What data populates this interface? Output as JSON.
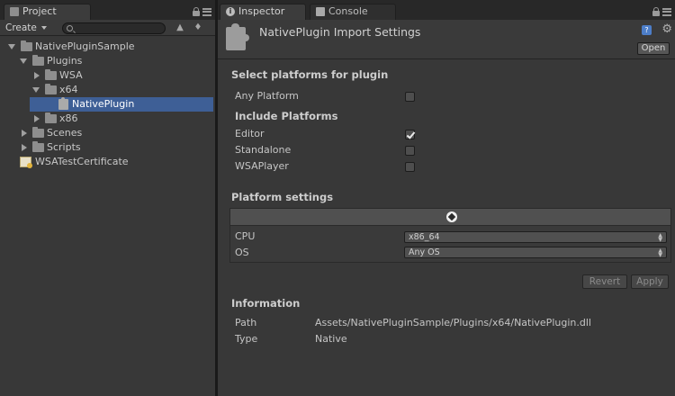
{
  "project_panel": {
    "tab_label": "Project",
    "create_label": "Create",
    "search_value": "",
    "tree": [
      {
        "label": "NativePluginSample",
        "type": "folder",
        "expanded": true
      },
      {
        "label": "Plugins",
        "type": "folder",
        "expanded": true
      },
      {
        "label": "WSA",
        "type": "folder",
        "expanded": false
      },
      {
        "label": "x64",
        "type": "folder",
        "expanded": true
      },
      {
        "label": "NativePlugin",
        "type": "plugin",
        "selected": true
      },
      {
        "label": "x86",
        "type": "folder",
        "expanded": false
      },
      {
        "label": "Scenes",
        "type": "folder",
        "expanded": false
      },
      {
        "label": "Scripts",
        "type": "folder",
        "expanded": false
      },
      {
        "label": "WSATestCertificate",
        "type": "certificate"
      }
    ]
  },
  "inspector": {
    "tab_label": "Inspector",
    "console_tab_label": "Console",
    "title": "NativePlugin Import Settings",
    "open_label": "Open",
    "select_platforms": {
      "title": "Select platforms for plugin",
      "any_platform": {
        "label": "Any Platform",
        "checked": false
      },
      "include_title": "Include Platforms",
      "platforms": [
        {
          "label": "Editor",
          "checked": true
        },
        {
          "label": "Standalone",
          "checked": false
        },
        {
          "label": "WSAPlayer",
          "checked": false
        }
      ]
    },
    "platform_settings": {
      "title": "Platform settings",
      "cpu": {
        "label": "CPU",
        "value": "x86_64"
      },
      "os": {
        "label": "OS",
        "value": "Any OS"
      }
    },
    "revert_label": "Revert",
    "apply_label": "Apply",
    "information": {
      "title": "Information",
      "path_label": "Path",
      "path_value": "Assets/NativePluginSample/Plugins/x64/NativePlugin.dll",
      "type_label": "Type",
      "type_value": "Native"
    }
  },
  "colors": {
    "panel_bg": "#383838",
    "selection": "#3e5f96",
    "help_icon": "#4d7ec8"
  }
}
